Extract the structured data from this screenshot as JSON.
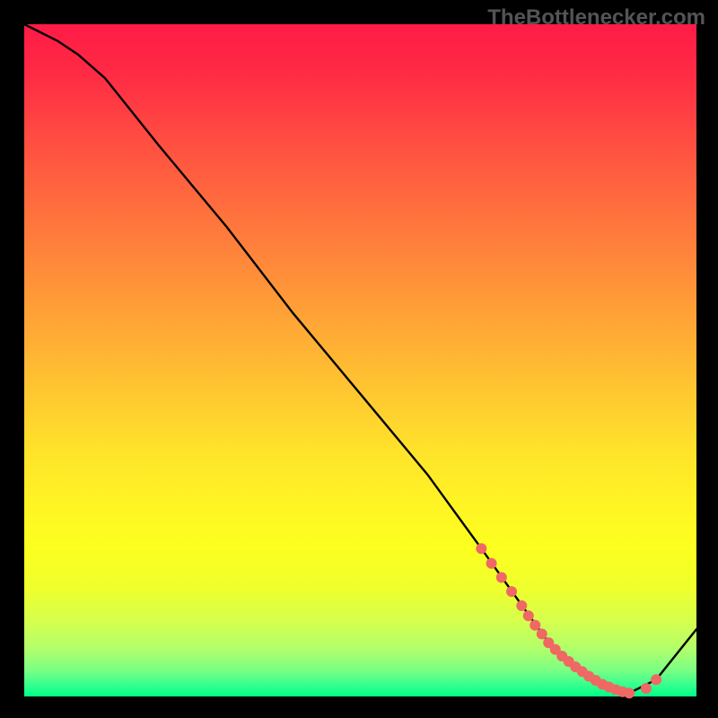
{
  "attribution": "TheBottlenecker.com",
  "chart_data": {
    "type": "line",
    "title": "",
    "xlabel": "",
    "ylabel": "",
    "xlim": [
      0,
      100
    ],
    "ylim": [
      0,
      100
    ],
    "series": [
      {
        "name": "curve",
        "color": "#000000",
        "x": [
          0,
          2,
          5,
          8,
          12,
          20,
          30,
          40,
          50,
          60,
          68,
          73,
          78,
          82,
          86,
          90,
          94,
          100
        ],
        "y": [
          100,
          99,
          97.5,
          95.5,
          92,
          82,
          70,
          57,
          45,
          33,
          22,
          15,
          8,
          4,
          1.5,
          0.5,
          2.5,
          10
        ]
      }
    ],
    "points": {
      "name": "highlight",
      "color": "#ef6864",
      "radius": 6,
      "x": [
        68,
        69.5,
        71,
        72.5,
        74,
        75,
        76,
        77,
        78,
        79,
        80,
        81,
        82,
        83,
        84,
        85,
        86,
        87,
        88,
        89,
        90,
        92.5,
        94
      ],
      "y": [
        22,
        19.8,
        17.7,
        15.6,
        13.5,
        12,
        10.6,
        9.3,
        8,
        7,
        6,
        5.2,
        4.4,
        3.7,
        3,
        2.4,
        1.8,
        1.4,
        1,
        0.7,
        0.5,
        1.2,
        2.5
      ]
    }
  }
}
